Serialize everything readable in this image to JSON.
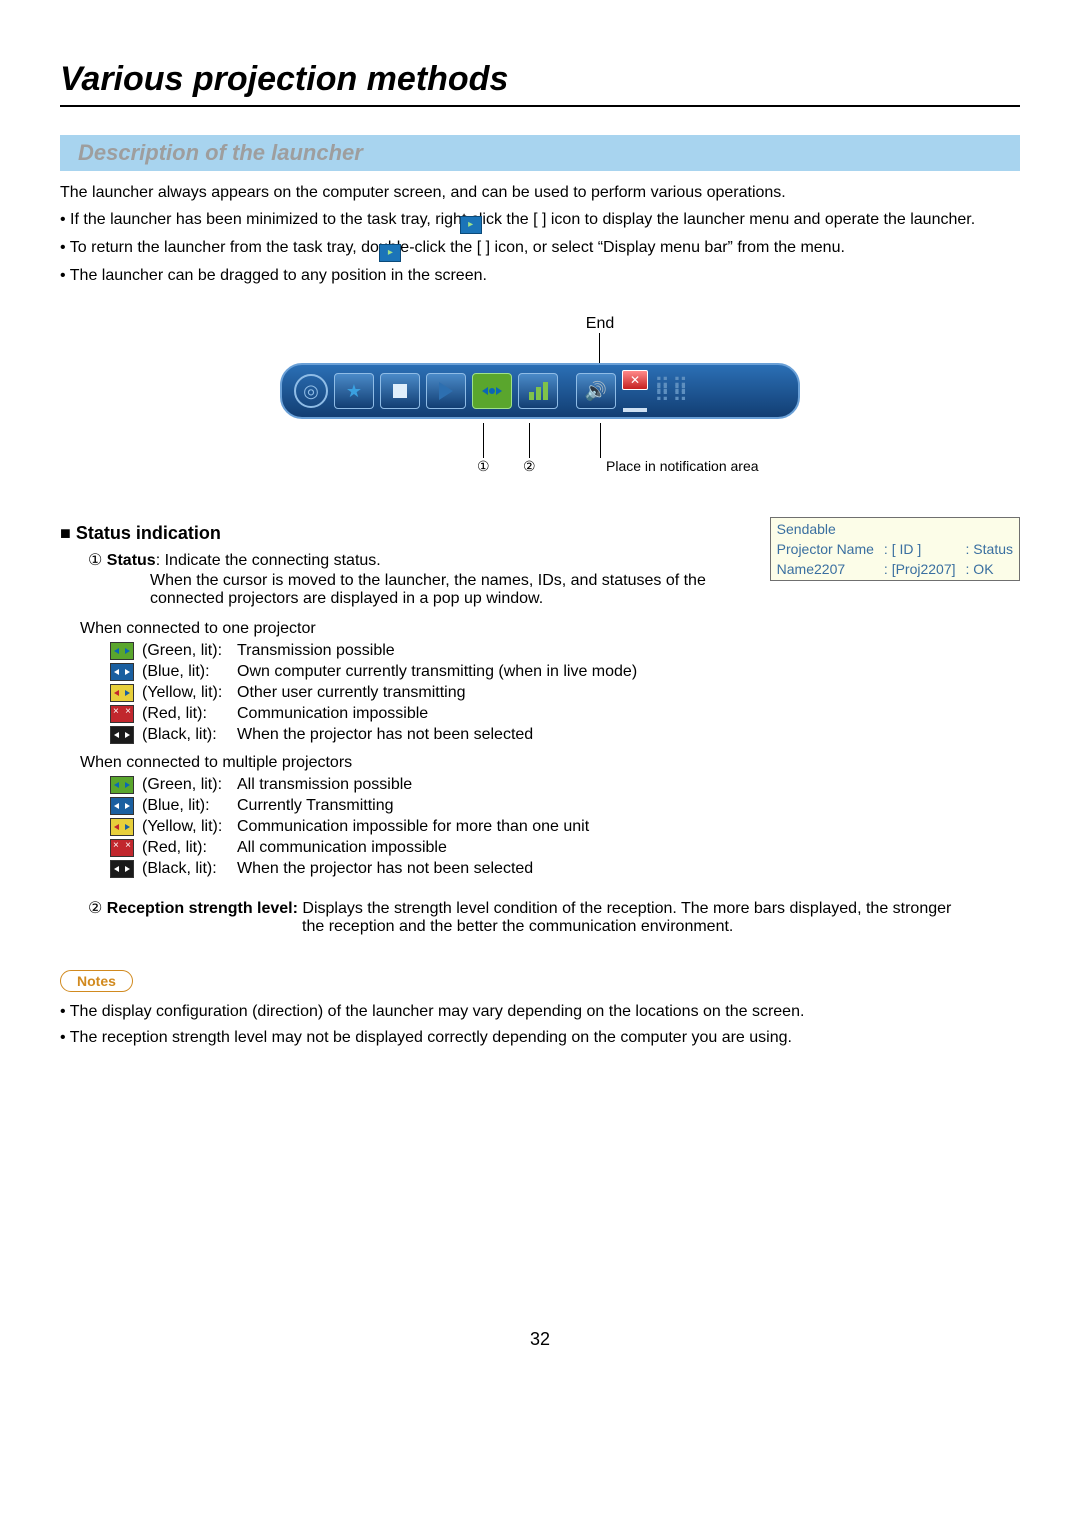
{
  "chapter_title": "Various projection methods",
  "section_title": "Description of the launcher",
  "intro_line": "The launcher always appears on the computer screen, and can be used to perform various operations.",
  "bullets": [
    "If the launcher has been minimized to the task tray, right click the [  ] icon to display the launcher menu and operate the launcher.",
    "To return the launcher from the task tray, double-click the [  ] icon, or select “Display menu bar” from the menu.",
    "The launcher can be dragged to any position in the screen."
  ],
  "figure": {
    "end_label": "End",
    "callout_1": "①",
    "callout_2": "②",
    "notif_label": "Place in notification area"
  },
  "popup": {
    "row1": "Sendable",
    "row2_a": "Projector Name",
    "row2_b": ": [    ID    ]",
    "row2_c": ": Status",
    "row3_a": "Name2207",
    "row3_b": ": [Proj2207]",
    "row3_c": ":  OK"
  },
  "status_header": "Status indication",
  "status_line_1a": "① ",
  "status_line_1b": "Status",
  "status_line_1c": ": Indicate the connecting status.",
  "status_line_2": "When the cursor is moved to the launcher, the names, IDs, and statuses of the connected projectors are displayed in a pop up window.",
  "one_proj_lead": "When connected to one projector",
  "one_proj_rows": [
    {
      "color": "(Green, lit):",
      "desc": "Transmission possible",
      "cls": "green"
    },
    {
      "color": "(Blue, lit):",
      "desc": "Own computer currently transmitting (when in live mode)",
      "cls": "blue"
    },
    {
      "color": "(Yellow, lit):",
      "desc": "Other user currently transmitting",
      "cls": "yellow"
    },
    {
      "color": "(Red, lit):",
      "desc": "Communication impossible",
      "cls": "red"
    },
    {
      "color": "(Black, lit):",
      "desc": "When the projector has not been selected",
      "cls": "black"
    }
  ],
  "multi_proj_lead": "When connected to multiple projectors",
  "multi_proj_rows": [
    {
      "color": "(Green, lit):",
      "desc": "All transmission possible",
      "cls": "green"
    },
    {
      "color": "(Blue, lit):",
      "desc": "Currently Transmitting",
      "cls": "blue"
    },
    {
      "color": "(Yellow, lit):",
      "desc": "Communication impossible for more than one unit",
      "cls": "yellow"
    },
    {
      "color": "(Red, lit):",
      "desc": "All communication impossible",
      "cls": "red"
    },
    {
      "color": "(Black, lit):",
      "desc": "When the projector has not been selected",
      "cls": "black"
    }
  ],
  "reception_num": "② ",
  "reception_bold": "Reception strength level:",
  "reception_text_1": " Displays the strength level condition of the reception. The more bars displayed, the stronger",
  "reception_text_2": "the reception and the better the communication environment.",
  "notes_label": "Notes",
  "notes": [
    "The display configuration (direction) of the launcher may vary depending on the locations on the screen.",
    "The reception strength level may not be displayed correctly depending on the computer you are using."
  ],
  "page_number": "32"
}
